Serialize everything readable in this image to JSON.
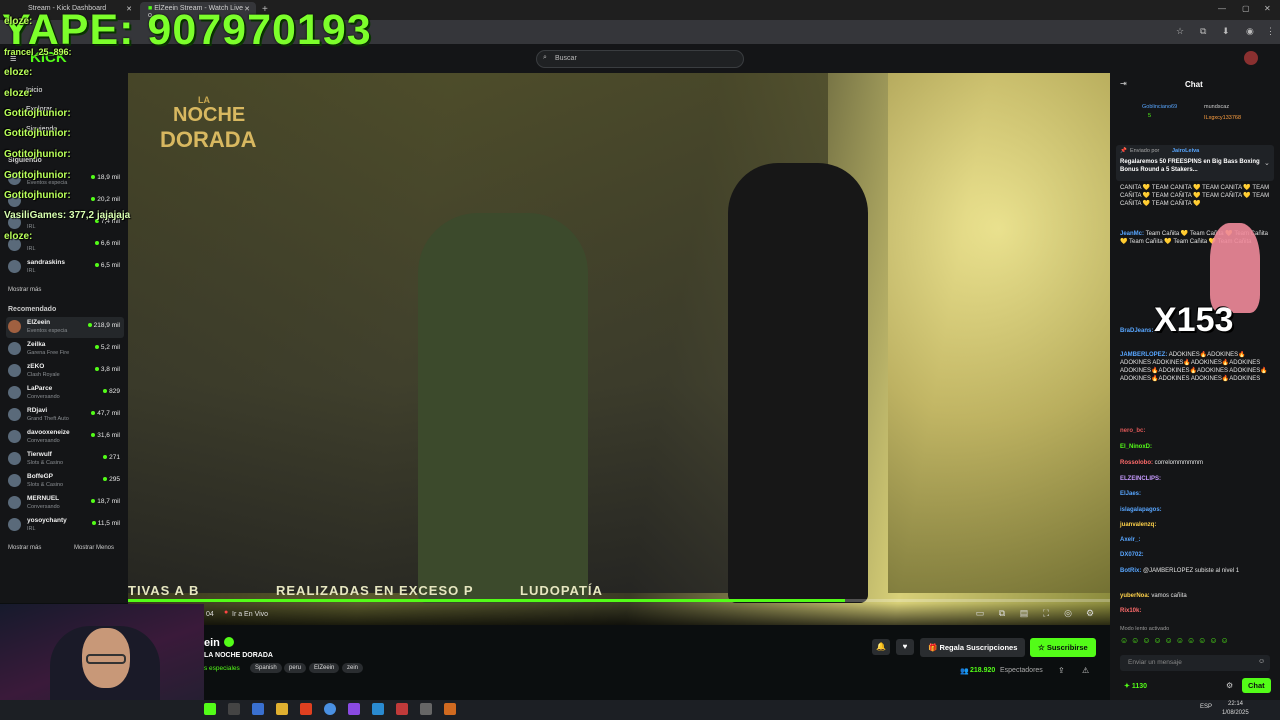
{
  "browser": {
    "tabs": [
      {
        "label": "Stream - Kick Dashboard"
      },
      {
        "label": "ElZeein Stream - Watch Live o"
      }
    ]
  },
  "kick": {
    "logo": "KICK",
    "search_placeholder": "Buscar"
  },
  "sidebar": {
    "inicio": "Inicio",
    "explorar": "Explorar",
    "siguiendo": "Siguiendo",
    "section_following": "Siguiendo",
    "following": [
      {
        "name": "",
        "category": "Eventos especia",
        "viewers": "18,9 mil"
      },
      {
        "name": "",
        "category": "",
        "viewers": "20,2 mil"
      },
      {
        "name": "",
        "category": "IRL",
        "viewers": "7,4 mil"
      },
      {
        "name": "",
        "category": "IRL",
        "viewers": "6,6 mil"
      },
      {
        "name": "sandraskins",
        "category": "IRL",
        "viewers": "6,5 mil"
      }
    ],
    "show_more": "Mostrar más",
    "section_recommended": "Recomendado",
    "recommended": [
      {
        "name": "ElZeein",
        "category": "Eventos especia",
        "viewers": "218,9 mil"
      },
      {
        "name": "Zeilka",
        "category": "Garena Free Fire",
        "viewers": "5,2 mil"
      },
      {
        "name": "zEKO",
        "category": "Clash Royale",
        "viewers": "3,8 mil"
      },
      {
        "name": "LaParce",
        "category": "Conversando",
        "viewers": "829"
      },
      {
        "name": "RDjavi",
        "category": "Grand Theft Auto",
        "viewers": "47,7 mil"
      },
      {
        "name": "davooxeneize",
        "category": "Conversando",
        "viewers": "31,6 mil"
      },
      {
        "name": "Tierwulf",
        "category": "Slots & Casino",
        "viewers": "271"
      },
      {
        "name": "BoffeGP",
        "category": "Slots & Casino",
        "viewers": "295"
      },
      {
        "name": "MERNUEL",
        "category": "Conversando",
        "viewers": "18,7 mil"
      },
      {
        "name": "yosoychanty",
        "category": "IRL",
        "viewers": "11,5 mil"
      }
    ],
    "show_more_2": "Mostrar más",
    "show_less": "Mostrar Menos"
  },
  "video": {
    "poster_title_1": "LA",
    "poster_title_2": "NOCHE",
    "poster_title_3": "DORADA",
    "ticker_1": "TIVAS A B",
    "ticker_2": "REALIZADAS EN EXCESO P",
    "ticker_3": "LUDOPATÍA",
    "progress": 0.73,
    "time": "04",
    "go_live": "Ir a En Vivo"
  },
  "stream": {
    "streamer": "ein",
    "title": "LA NOCHE DORADA",
    "category": "s especiales",
    "tags": [
      "Spanish",
      "peru",
      "ElZeein",
      "zein"
    ],
    "gift_label": "Regala Suscripciones",
    "subscribe_label": "Suscribirse",
    "viewers": "218.920",
    "viewers_label": "Espectadores"
  },
  "chat": {
    "title": "Chat",
    "top_gifters": [
      "Goblinciano69",
      "mundscaz",
      "ILxgxcy133768"
    ],
    "top_gifter_count": "5",
    "pinned_by_label": "Enviado por",
    "pinned_by": "JairoLeiva",
    "pinned_text": "Regalaremos 50 FREESPINS en Big Bass Boxing Bonus Round a 5 Stakers...",
    "messages": [
      {
        "user": "",
        "text": "CAÑITA 💛 TEAM CAÑITA 💛 TEAM CAÑITA 💛 TEAM CAÑITA 💛 TEAM CAÑITA 💛 TEAM CAÑITA 💛 TEAM CAÑITA 💛 TEAM CAÑITA 💛",
        "color": "#e3e3e3"
      },
      {
        "user": "JeanMc:",
        "text": "Team Cañita 💛 Team Cañita 💛 Team Cañita 💛 Team Cañita 💛 Team Cañita 💛 Team Cañita",
        "color": "#58a6ff"
      },
      {
        "user": "BraDJeans:",
        "text": "",
        "color": "#58a6ff"
      },
      {
        "user": "JAMBERLOPEZ:",
        "text": "ADOKINES🔥ADOKINES🔥ADOKINES ADOKINES🔥ADOKINES🔥ADOKINES ADOKINES🔥ADOKINES🔥ADOKINES ADOKINES🔥ADOKINES🔥ADOKINES ADOKINES🔥ADOKINES",
        "color": "#58a6ff"
      },
      {
        "user": "nero_bc:",
        "text": "",
        "color": "#e05858"
      },
      {
        "user": "El_NinoxD:",
        "text": "",
        "color": "#53fc18"
      },
      {
        "user": "Rossolobo:",
        "text": "correlommmmmm",
        "color": "#ff6b6b"
      },
      {
        "user": "ELZEINCLIPS:",
        "text": "",
        "color": "#c79bff"
      },
      {
        "user": "ElJaes:",
        "text": "",
        "color": "#58a6ff"
      },
      {
        "user": "islagalapagos:",
        "text": "",
        "color": "#58a6ff"
      },
      {
        "user": "juanvalenzq:",
        "text": "",
        "color": "#ffd24a"
      },
      {
        "user": "Axelr_:",
        "text": "",
        "color": "#58a6ff"
      },
      {
        "user": "DX0702:",
        "text": "",
        "color": "#58a6ff"
      },
      {
        "user": "BotRix:",
        "text": "@JAMBERLOPEZ subiste al nivel 1",
        "color": "#58a6ff"
      },
      {
        "user": "yuberNoa:",
        "text": "vamos cañita",
        "color": "#ffd24a"
      },
      {
        "user": "Rix10k:",
        "text": "",
        "color": "#ff6b6b"
      }
    ],
    "slow_mode": "Modo lento activado",
    "input_placeholder": "Enviar un mensaje",
    "points": "1130",
    "send_label": "Chat",
    "overlay_badge": "X153"
  },
  "overlay": {
    "yape": "YAPE: 907970193",
    "messages": [
      "eloze:",
      "francel_25_896:",
      "eloze:",
      "eloze:",
      "Gotitojhunior:",
      "Gotitojhunior:",
      "Gotitojhunior:",
      "Gotitojhunior:",
      "Gotitojhunior:",
      "VasiliGames: 377,2 jajajaja",
      "eloze:"
    ]
  },
  "taskbar": {
    "language": "ESP",
    "time": "22:14",
    "date": "1/08/2025"
  },
  "colors": {
    "kick_green": "#53fc18",
    "bg": "#0b0e0f",
    "panel": "#141517"
  }
}
